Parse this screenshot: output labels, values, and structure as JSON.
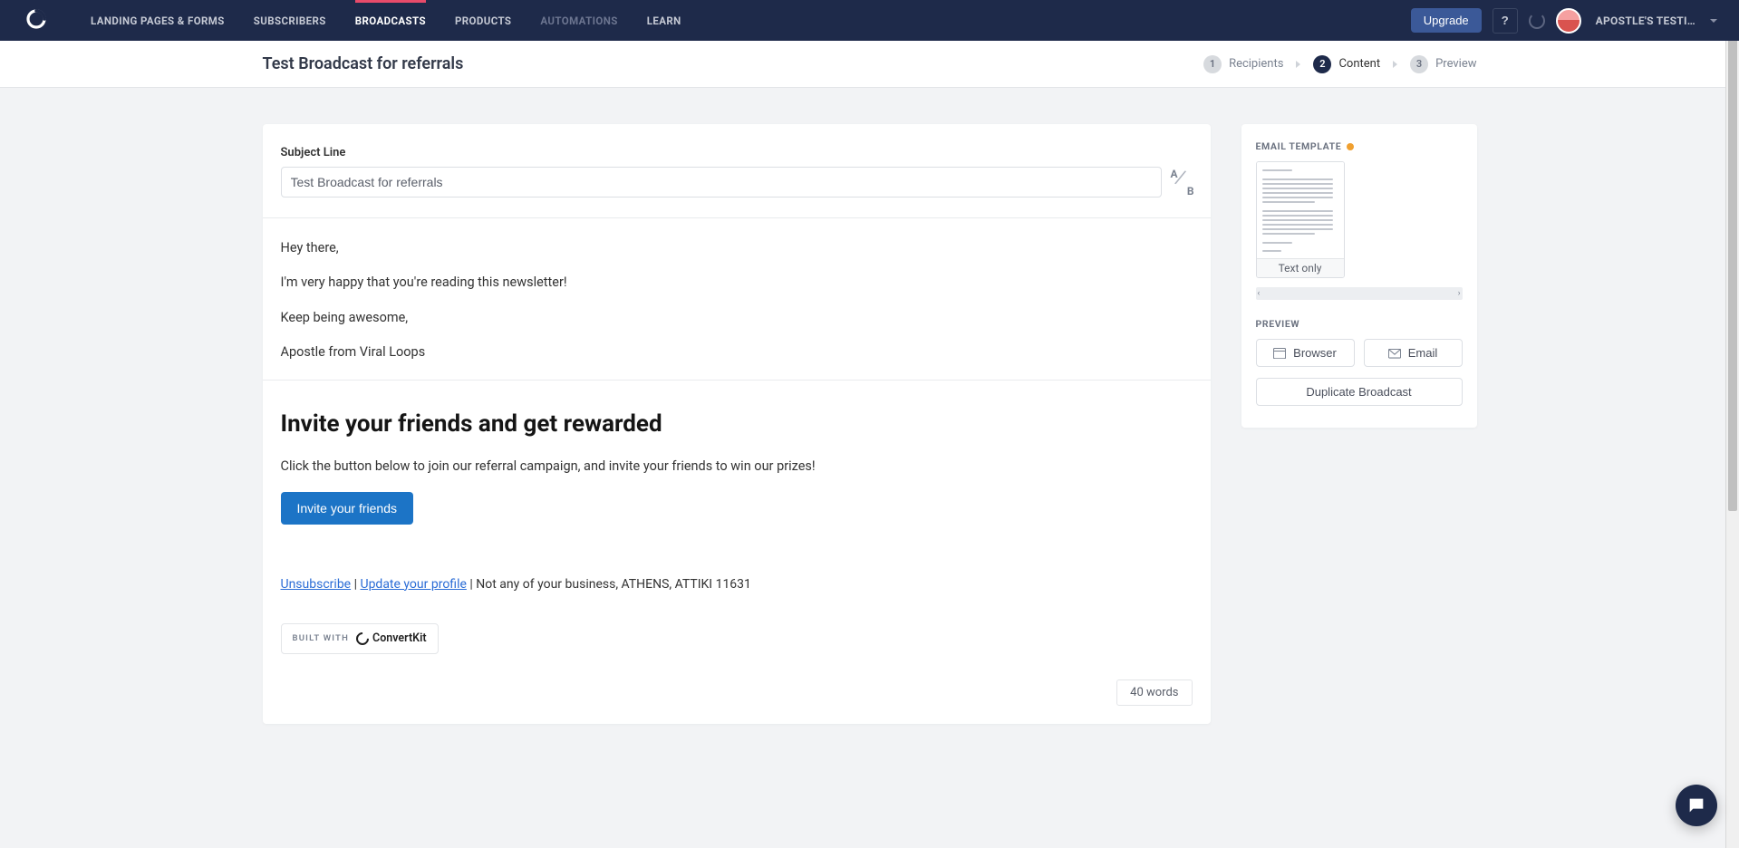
{
  "nav": {
    "items": [
      "LANDING PAGES & FORMS",
      "SUBSCRIBERS",
      "BROADCASTS",
      "PRODUCTS",
      "AUTOMATIONS",
      "LEARN"
    ],
    "upgrade": "Upgrade",
    "help": "?",
    "user": "APOSTLE'S TESTI…"
  },
  "subheader": {
    "title": "Test Broadcast for referrals",
    "steps": [
      {
        "num": "1",
        "label": "Recipients"
      },
      {
        "num": "2",
        "label": "Content"
      },
      {
        "num": "3",
        "label": "Preview"
      }
    ]
  },
  "editor": {
    "subject_label": "Subject Line",
    "subject_value": "Test Broadcast for referrals",
    "ab_a": "A",
    "ab_b": "B",
    "body": {
      "p1": "Hey there,",
      "p2": "I'm very happy that you're reading this newsletter!",
      "p3": "Keep being awesome,",
      "p4": "Apostle from Viral Loops",
      "heading": "Invite your friends and get rewarded",
      "p5": "Click the button below to join our referral campaign, and invite your friends to win our prizes!",
      "cta": "Invite your friends"
    },
    "footer": {
      "unsubscribe": "Unsubscribe",
      "update": "Update your profile",
      "sep1": " | ",
      "sep2": " | ",
      "address": "Not any of your business, ATHENS, ATTIKI 11631"
    },
    "built_with_label": "BUILT WITH",
    "built_with_brand": "ConvertKit",
    "word_count": "40 words"
  },
  "side": {
    "template_label": "EMAIL TEMPLATE",
    "template_name": "Text only",
    "nav_prev": "‹",
    "nav_next": "›",
    "preview_label": "PREVIEW",
    "browser": "Browser",
    "email": "Email",
    "duplicate": "Duplicate Broadcast"
  }
}
